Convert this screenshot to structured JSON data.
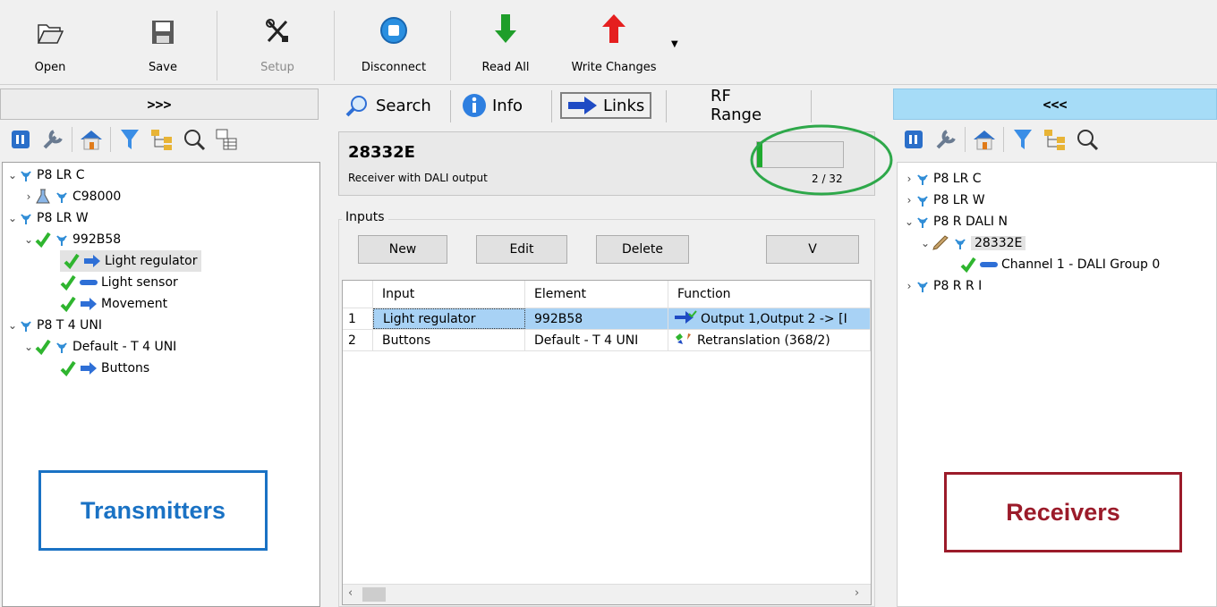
{
  "toolbar": {
    "open": "Open",
    "save": "Save",
    "setup": "Setup",
    "disconnect": "Disconnect",
    "read_all": "Read All",
    "write_changes": "Write Changes"
  },
  "left_panel": {
    "toggle": ">>>",
    "tree": [
      {
        "label": "P8 LR C"
      },
      {
        "label": "C98000"
      },
      {
        "label": "P8 LR W"
      },
      {
        "label": "992B58"
      },
      {
        "label": "Light regulator"
      },
      {
        "label": "Light sensor"
      },
      {
        "label": "Movement"
      },
      {
        "label": "P8 T 4 UNI"
      },
      {
        "label": "Default - T 4 UNI"
      },
      {
        "label": "Buttons"
      }
    ],
    "callout": "Transmitters"
  },
  "center_panel": {
    "tabs": {
      "search": "Search",
      "info": "Info",
      "links": "Links",
      "rf_range": "RF Range"
    },
    "device": {
      "name": "28332E",
      "description": "Receiver with DALI output",
      "progress_text": "2 / 32",
      "progress_fraction": 0.0625
    },
    "inputs": {
      "label": "Inputs",
      "buttons": {
        "new": "New",
        "edit": "Edit",
        "delete": "Delete",
        "v": "V"
      },
      "columns": [
        "Input",
        "Element",
        "Function"
      ],
      "rows": [
        {
          "num": "1",
          "input": "Light regulator",
          "element": "992B58",
          "function": "Output 1,Output 2 -> [I"
        },
        {
          "num": "2",
          "input": "Buttons",
          "element": "Default - T 4 UNI",
          "function": "Retranslation (368/2)"
        }
      ]
    }
  },
  "right_panel": {
    "toggle": "<<<",
    "tree": [
      {
        "label": "P8 LR C"
      },
      {
        "label": "P8 LR W"
      },
      {
        "label": "P8 R DALI N"
      },
      {
        "label": "28332E"
      },
      {
        "label": "Channel 1 - DALI Group 0"
      },
      {
        "label": "P8 R R I"
      }
    ],
    "callout": "Receivers"
  },
  "colors": {
    "transmitters": "#1a72c4",
    "receivers": "#9b1b2a",
    "highlight_circle": "#2ea84a",
    "right_header": "#a6dcf7",
    "selected_row": "#a8d2f5"
  }
}
